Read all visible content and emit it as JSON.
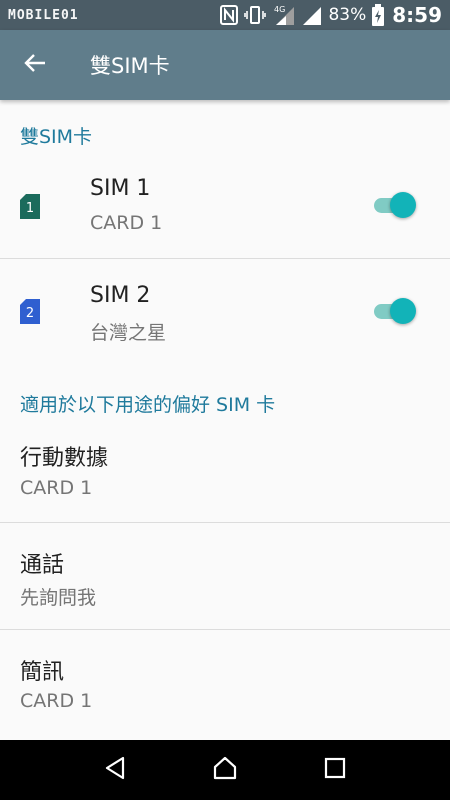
{
  "status_bar": {
    "watermark": "MOBILE01",
    "battery_percent": "83%",
    "time": "8:59",
    "network_label": "4G",
    "icons": [
      "nfc-icon",
      "vibrate-icon",
      "signal-icon",
      "signal-icon",
      "battery-charging-icon"
    ]
  },
  "toolbar": {
    "title": "雙SIM卡",
    "back_icon": "arrow-back-icon"
  },
  "sections": {
    "dual_sim_header": "雙SIM卡",
    "preferred_header": "適用於以下用途的偏好 SIM 卡"
  },
  "sims": [
    {
      "slot": "1",
      "title": "SIM 1",
      "subtitle": "CARD 1",
      "enabled": true,
      "color": "#1b6b5c"
    },
    {
      "slot": "2",
      "title": "SIM 2",
      "subtitle": "台灣之星",
      "enabled": true,
      "color": "#2f5fd0"
    }
  ],
  "preferences": [
    {
      "title": "行動數據",
      "value": "CARD 1"
    },
    {
      "title": "通話",
      "value": "先詢問我"
    },
    {
      "title": "簡訊",
      "value": "CARD 1"
    }
  ],
  "colors": {
    "status_bar": "#4b5c66",
    "toolbar": "#607d8b",
    "accent": "#1f7a9c",
    "toggle_on": "#12b3b8"
  },
  "nav": {
    "icons": [
      "back-triangle-icon",
      "home-icon",
      "recents-square-icon"
    ]
  }
}
